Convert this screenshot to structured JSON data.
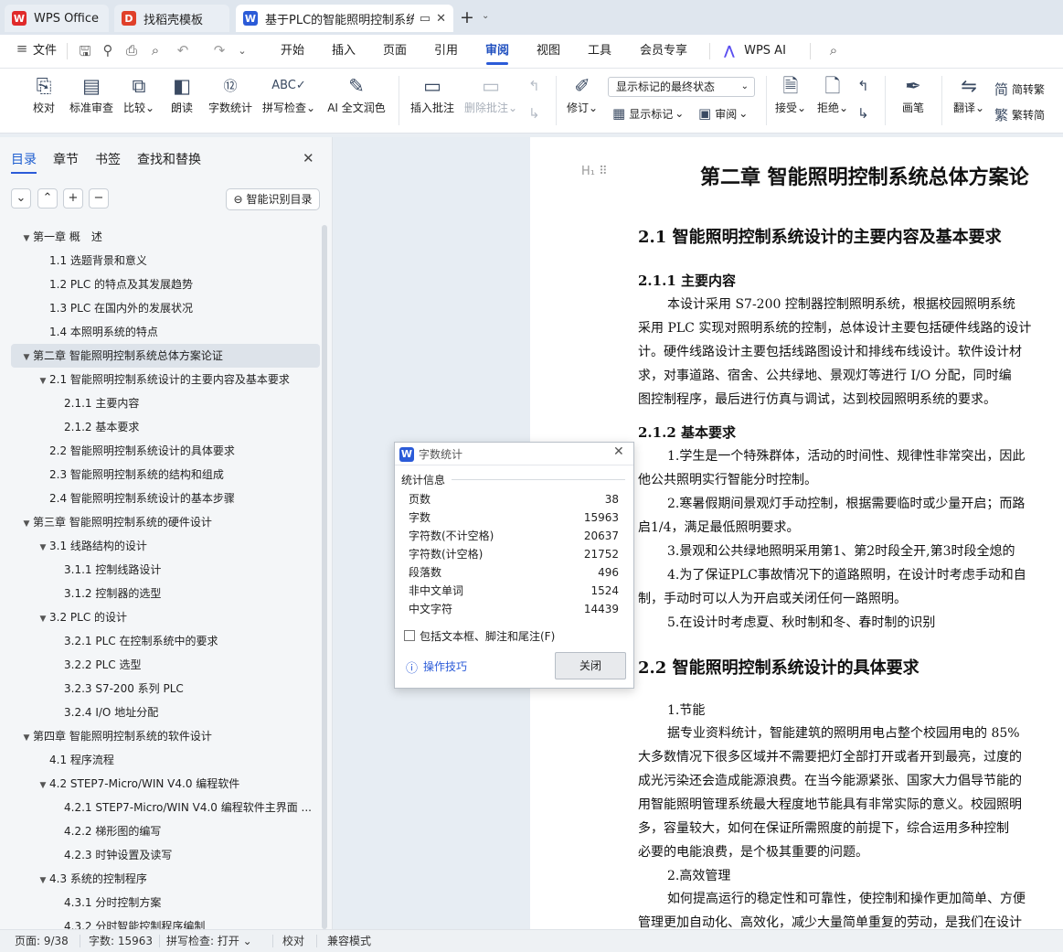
{
  "tabs": [
    {
      "label": "WPS Office",
      "icon": "wps-logo-icon",
      "color": "#e02a2a"
    },
    {
      "label": "找稻壳模板",
      "icon": "docer-logo-icon",
      "color": "#e0402a"
    },
    {
      "label": "基于PLC的智能照明控制系统",
      "icon": "word-doc-icon",
      "color": "#2b5bd8"
    }
  ],
  "menubar": {
    "file": "文件",
    "items": [
      "开始",
      "插入",
      "页面",
      "引用",
      "审阅",
      "视图",
      "工具",
      "会员专享"
    ],
    "selected": "审阅",
    "ai": "WPS AI"
  },
  "ribbon": {
    "proofread": "校对",
    "std_review": "标准审查",
    "compare": "比较",
    "read_aloud": "朗读",
    "word_count": "字数统计",
    "spell_check": "拼写检查",
    "ai_polish": "AI 全文润色",
    "insert_comment": "插入批注",
    "delete_comment": "删除批注",
    "revise": "修订",
    "markup_select": "显示标记的最终状态",
    "show_markup": "显示标记",
    "review": "审阅",
    "accept": "接受",
    "reject": "拒绝",
    "pen": "画笔",
    "translate": "翻译",
    "to_trad": "简转繁",
    "to_simp": "繁转简"
  },
  "nav": {
    "tabs": [
      "目录",
      "章节",
      "书签",
      "查找和替换"
    ],
    "smart_toc": "智能识别目录",
    "toc": [
      {
        "text": "第一章  概　述",
        "level": 0,
        "arrow": true
      },
      {
        "text": "1.1  选题背景和意义",
        "level": 1
      },
      {
        "text": "1.2 PLC 的特点及其发展趋势",
        "level": 1
      },
      {
        "text": "1.3 PLC 在国内外的发展状况",
        "level": 1
      },
      {
        "text": "1.4  本照明系统的特点",
        "level": 1
      },
      {
        "text": "第二章  智能照明控制系统总体方案论证",
        "level": 0,
        "arrow": true,
        "highlight": true
      },
      {
        "text": "2.1  智能照明控制系统设计的主要内容及基本要求",
        "level": 1,
        "arrow": true
      },
      {
        "text": "2.1.1  主要内容",
        "level": 2
      },
      {
        "text": "2.1.2  基本要求",
        "level": 2
      },
      {
        "text": "2.2  智能照明控制系统设计的具体要求",
        "level": 1
      },
      {
        "text": "2.3  智能照明控制系统的结构和组成",
        "level": 1
      },
      {
        "text": "2.4  智能照明控制系统设计的基本步骤",
        "level": 1
      },
      {
        "text": "第三章  智能照明控制系统的硬件设计",
        "level": 0,
        "arrow": true
      },
      {
        "text": "3.1  线路结构的设计",
        "level": 1,
        "arrow": true
      },
      {
        "text": "3.1.1  控制线路设计",
        "level": 2
      },
      {
        "text": "3.1.2  控制器的选型",
        "level": 2
      },
      {
        "text": "3.2 PLC 的设计",
        "level": 1,
        "arrow": true
      },
      {
        "text": "3.2.1 PLC 在控制系统中的要求",
        "level": 2
      },
      {
        "text": "3.2.2 PLC 选型",
        "level": 2
      },
      {
        "text": "3.2.3 S7-200 系列 PLC",
        "level": 2
      },
      {
        "text": "3.2.4 I/O 地址分配",
        "level": 2
      },
      {
        "text": "第四章  智能照明控制系统的软件设计",
        "level": 0,
        "arrow": true
      },
      {
        "text": "4.1  程序流程",
        "level": 1
      },
      {
        "text": "4.2 STEP7-Micro/WIN V4.0 编程软件",
        "level": 1,
        "arrow": true
      },
      {
        "text": "4.2.1 STEP7-Micro/WIN V4.0 编程软件主界面 ...",
        "level": 2
      },
      {
        "text": "4.2.2  梯形图的编写",
        "level": 2
      },
      {
        "text": "4.2.3  时钟设置及读写",
        "level": 2
      },
      {
        "text": "4.3  系统的控制程序",
        "level": 1,
        "arrow": true
      },
      {
        "text": "4.3.1  分时控制方案",
        "level": 2
      },
      {
        "text": "4.3.2  分时智能控制程序编制",
        "level": 2
      }
    ]
  },
  "doc": {
    "chapter_title": "第二章  智能照明控制系统总体方案论",
    "sec_2_1": "2.1  智能照明控制系统设计的主要内容及基本要求",
    "sec_2_1_1": "2.1.1  主要内容",
    "para1": [
      "本设计采用 S7-200 控制器控制照明系统，根据校园照明系统",
      "采用 PLC 实现对照明系统的控制，总体设计主要包括硬件线路的设计",
      "计。硬件线路设计主要包括线路图设计和排线布线设计。软件设计材",
      "求，对事道路、宿舍、公共绿地、景观灯等进行 I/O 分配，同时编",
      "图控制程序，最后进行仿真与调试，达到校园照明系统的要求。"
    ],
    "sec_2_1_2": "2.1.2  基本要求",
    "para2": [
      "1.学生是一个特殊群体，活动的时间性、规律性非常突出，因此",
      "他公共照明实行智能分时控制。",
      "2.寒暑假期间景观灯手动控制，根据需要临时或少量开启；而路",
      "启1/4，满足最低照明要求。",
      "3.景观和公共绿地照明采用第1、第2时段全开,第3时段全熄的",
      "4.为了保证PLC事故情况下的道路照明，在设计时考虑手动和自",
      "制，手动时可以人为开启或关闭任何一路照明。",
      "5.在设计时考虑夏、秋时制和冬、春时制的识别"
    ],
    "sec_2_2": "2.2  智能照明控制系统设计的具体要求",
    "para3": [
      "1.节能",
      "据专业资料统计，智能建筑的照明用电占整个校园用电的 85%",
      "大多数情况下很多区域并不需要把灯全部打开或者开到最亮，过度的",
      "成光污染还会造成能源浪费。在当今能源紧张、国家大力倡导节能的",
      "用智能照明管理系统最大程度地节能具有非常实际的意义。校园照明",
      "多，容量较大，如何在保证所需照度的前提下，综合运用多种控制",
      "必要的电能浪费，是个极其重要的问题。",
      "2.高效管理",
      "如何提高运行的稳定性和可靠性，使控制和操作更加简单、方便",
      "管理更加自动化、高效化，减少大量简单重复的劳动，是我们在设计"
    ]
  },
  "dialog": {
    "title": "字数统计",
    "section": "统计信息",
    "rows": [
      {
        "label": "页数",
        "value": "38"
      },
      {
        "label": "字数",
        "value": "15963"
      },
      {
        "label": "字符数(不计空格)",
        "value": "20637"
      },
      {
        "label": "字符数(计空格)",
        "value": "21752"
      },
      {
        "label": "段落数",
        "value": "496"
      },
      {
        "label": "非中文单词",
        "value": "1524"
      },
      {
        "label": "中文字符",
        "value": "14439"
      }
    ],
    "checkbox": "包括文本框、脚注和尾注(F)",
    "tips": "操作技巧",
    "close": "关闭"
  },
  "status": {
    "page": "页面: 9/38",
    "words": "字数: 15963",
    "spell": "拼写检查: 打开",
    "proof": "校对",
    "compat": "兼容模式"
  }
}
